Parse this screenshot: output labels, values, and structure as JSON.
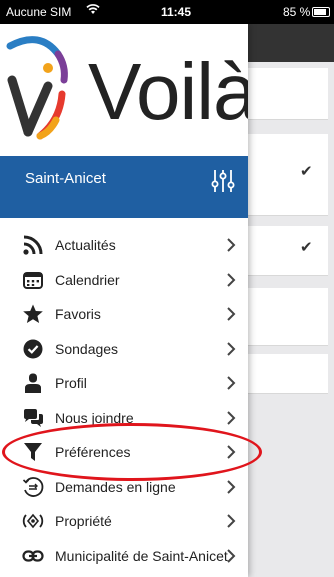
{
  "status_bar": {
    "carrier": "Aucune SIM",
    "time": "11:45",
    "battery": "85 %",
    "battery_level": 0.85
  },
  "logo": {
    "text": "Voilà",
    "accent_colors": [
      "#2a7ec4",
      "#f2a31b",
      "#e63a2e",
      "#7b3f98"
    ]
  },
  "location": {
    "name": "Saint-Anicet",
    "filter_icon": "sliders-icon"
  },
  "menu": {
    "items": [
      {
        "label": "Actualités",
        "icon": "rss-icon"
      },
      {
        "label": "Calendrier",
        "icon": "calendar-icon"
      },
      {
        "label": "Favoris",
        "icon": "star-icon"
      },
      {
        "label": "Sondages",
        "icon": "check-circle-icon"
      },
      {
        "label": "Profil",
        "icon": "person-icon"
      },
      {
        "label": "Nous joindre",
        "icon": "chat-icon"
      },
      {
        "label": "Préférences",
        "icon": "funnel-icon"
      },
      {
        "label": "Demandes en ligne",
        "icon": "request-icon"
      },
      {
        "label": "Propriété",
        "icon": "property-icon"
      },
      {
        "label": "Municipalité de Saint-Anicet",
        "icon": "link-icon"
      }
    ]
  },
  "colors": {
    "location_bar": "#1f5fa2",
    "highlight": "#e0151c"
  }
}
